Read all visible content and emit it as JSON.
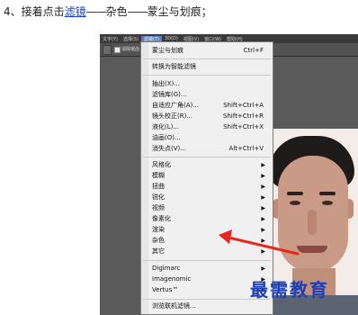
{
  "instruction": {
    "prefix": "4、接着点击",
    "link": "滤镜",
    "dash1": "——",
    "middle": "杂色",
    "dash2": "——",
    "suffix": "蒙尘与划痕；"
  },
  "menubar": {
    "items": [
      "文字(Y)",
      "选择(S)",
      "滤镜(T)",
      "3D(D)",
      "视图(V)",
      "窗口(W)",
      "帮助(H)"
    ]
  },
  "optionsbar": {
    "checkbox_label": "消除锯齿"
  },
  "menu": {
    "last_filter": {
      "label": "蒙尘与划痕",
      "shortcut": "Ctrl+F"
    },
    "smart_filter": "转换为智能滤镜",
    "group1": [
      {
        "label": "抽出(X)...",
        "shortcut": ""
      },
      {
        "label": "滤镜库(G)...",
        "shortcut": ""
      },
      {
        "label": "自适应广角(A)...",
        "shortcut": "Shift+Ctrl+A"
      },
      {
        "label": "镜头校正(R)...",
        "shortcut": "Shift+Ctrl+R"
      },
      {
        "label": "液化(L)...",
        "shortcut": "Shift+Ctrl+X"
      },
      {
        "label": "油画(O)...",
        "shortcut": ""
      },
      {
        "label": "消失点(V)...",
        "shortcut": "Alt+Ctrl+V"
      }
    ],
    "group2": [
      "风格化",
      "模糊",
      "扭曲",
      "锐化",
      "视频",
      "像素化",
      "渲染",
      "杂色",
      "其它"
    ],
    "group3": [
      "Digimarc",
      "Imagenomic",
      "Vertus™"
    ],
    "browse": "浏览联机滤镜..."
  },
  "watermark": "最需教育",
  "colors": {
    "link": "#1a3fd0",
    "arrow": "#e8281e",
    "watermark": "#1c3fb8",
    "menu_bg": "#f0f0f0"
  }
}
